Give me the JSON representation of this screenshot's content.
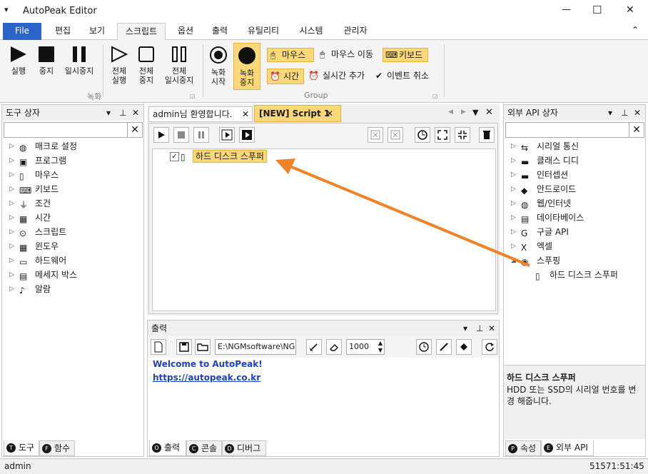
{
  "app": {
    "title": "AutoPeak Editor",
    "menu_glyph": "▾"
  },
  "window_controls": {
    "minimize": "—",
    "maximize": "☐",
    "close": "✕"
  },
  "ribbon_tabs": [
    "File",
    "편집",
    "보기",
    "스크립트",
    "옵션",
    "출력",
    "유틸리티",
    "시스템",
    "관리자"
  ],
  "ribbon": {
    "run": "실행",
    "stop": "중지",
    "pause": "일시중지",
    "all_run": "전체\n실행",
    "all_stop": "전체\n중지",
    "all_pause": "전체\n일시중지",
    "rec_start": "녹화\n시작",
    "rec_stop": "녹화\n중지",
    "mouse": "마우스",
    "mouse_move": "마우스 이동",
    "keyboard": "키보드",
    "time": "시간",
    "realtime_add": "실시간 추가",
    "event_cancel": "이벤트 취소",
    "group_record": "녹화",
    "group_group": "Group",
    "collapse": "⌃"
  },
  "left_panel": {
    "title": "도구 상자",
    "search_placeholder": "",
    "items": [
      "매크로 설정",
      "프로그램",
      "마우스",
      "키보드",
      "조건",
      "시간",
      "스크립트",
      "윈도우",
      "하드웨어",
      "메세지 박스",
      "알람"
    ],
    "tabs": [
      {
        "badge": "T",
        "label": "도구"
      },
      {
        "badge": "F",
        "label": "함수"
      }
    ]
  },
  "doc_tabs": [
    {
      "label": "admin님 환영합니다."
    },
    {
      "label": "[NEW] Script 1"
    }
  ],
  "script": {
    "item_label": "하드 디스크 스푸퍼"
  },
  "output": {
    "title": "출력",
    "path": "E:\\NGMsoftware\\NG",
    "count": "1000",
    "lines": [
      "Welcome to AutoPeak!",
      "https://autopeak.co.kr"
    ],
    "tabs": [
      {
        "badge": "O",
        "label": "출력"
      },
      {
        "badge": "C",
        "label": "콘솔"
      },
      {
        "badge": "D",
        "label": "디버그"
      }
    ]
  },
  "right_panel": {
    "title": "외부 API 상자",
    "items": [
      "시리얼 통신",
      "클래스 디디",
      "인터셉션",
      "안드로이드",
      "웹/인터넷",
      "데이타베이스",
      "구글 API",
      "엑셀",
      "스푸핑"
    ],
    "child": "하드 디스크 스푸퍼",
    "desc_title": "하드 디스크 스푸퍼",
    "desc_text": "HDD 또는 SSD의 시리얼 번호를 변경 해줍니다.",
    "tabs": [
      {
        "badge": "P",
        "label": "속성"
      },
      {
        "badge": "E",
        "label": "외부 API"
      }
    ]
  },
  "status": {
    "user": "admin",
    "time": "51571:51:45"
  },
  "colors": {
    "accent": "#2b64c8",
    "highlight": "#fbd97a",
    "arrow": "#f08228",
    "link": "#1f3fbf"
  }
}
